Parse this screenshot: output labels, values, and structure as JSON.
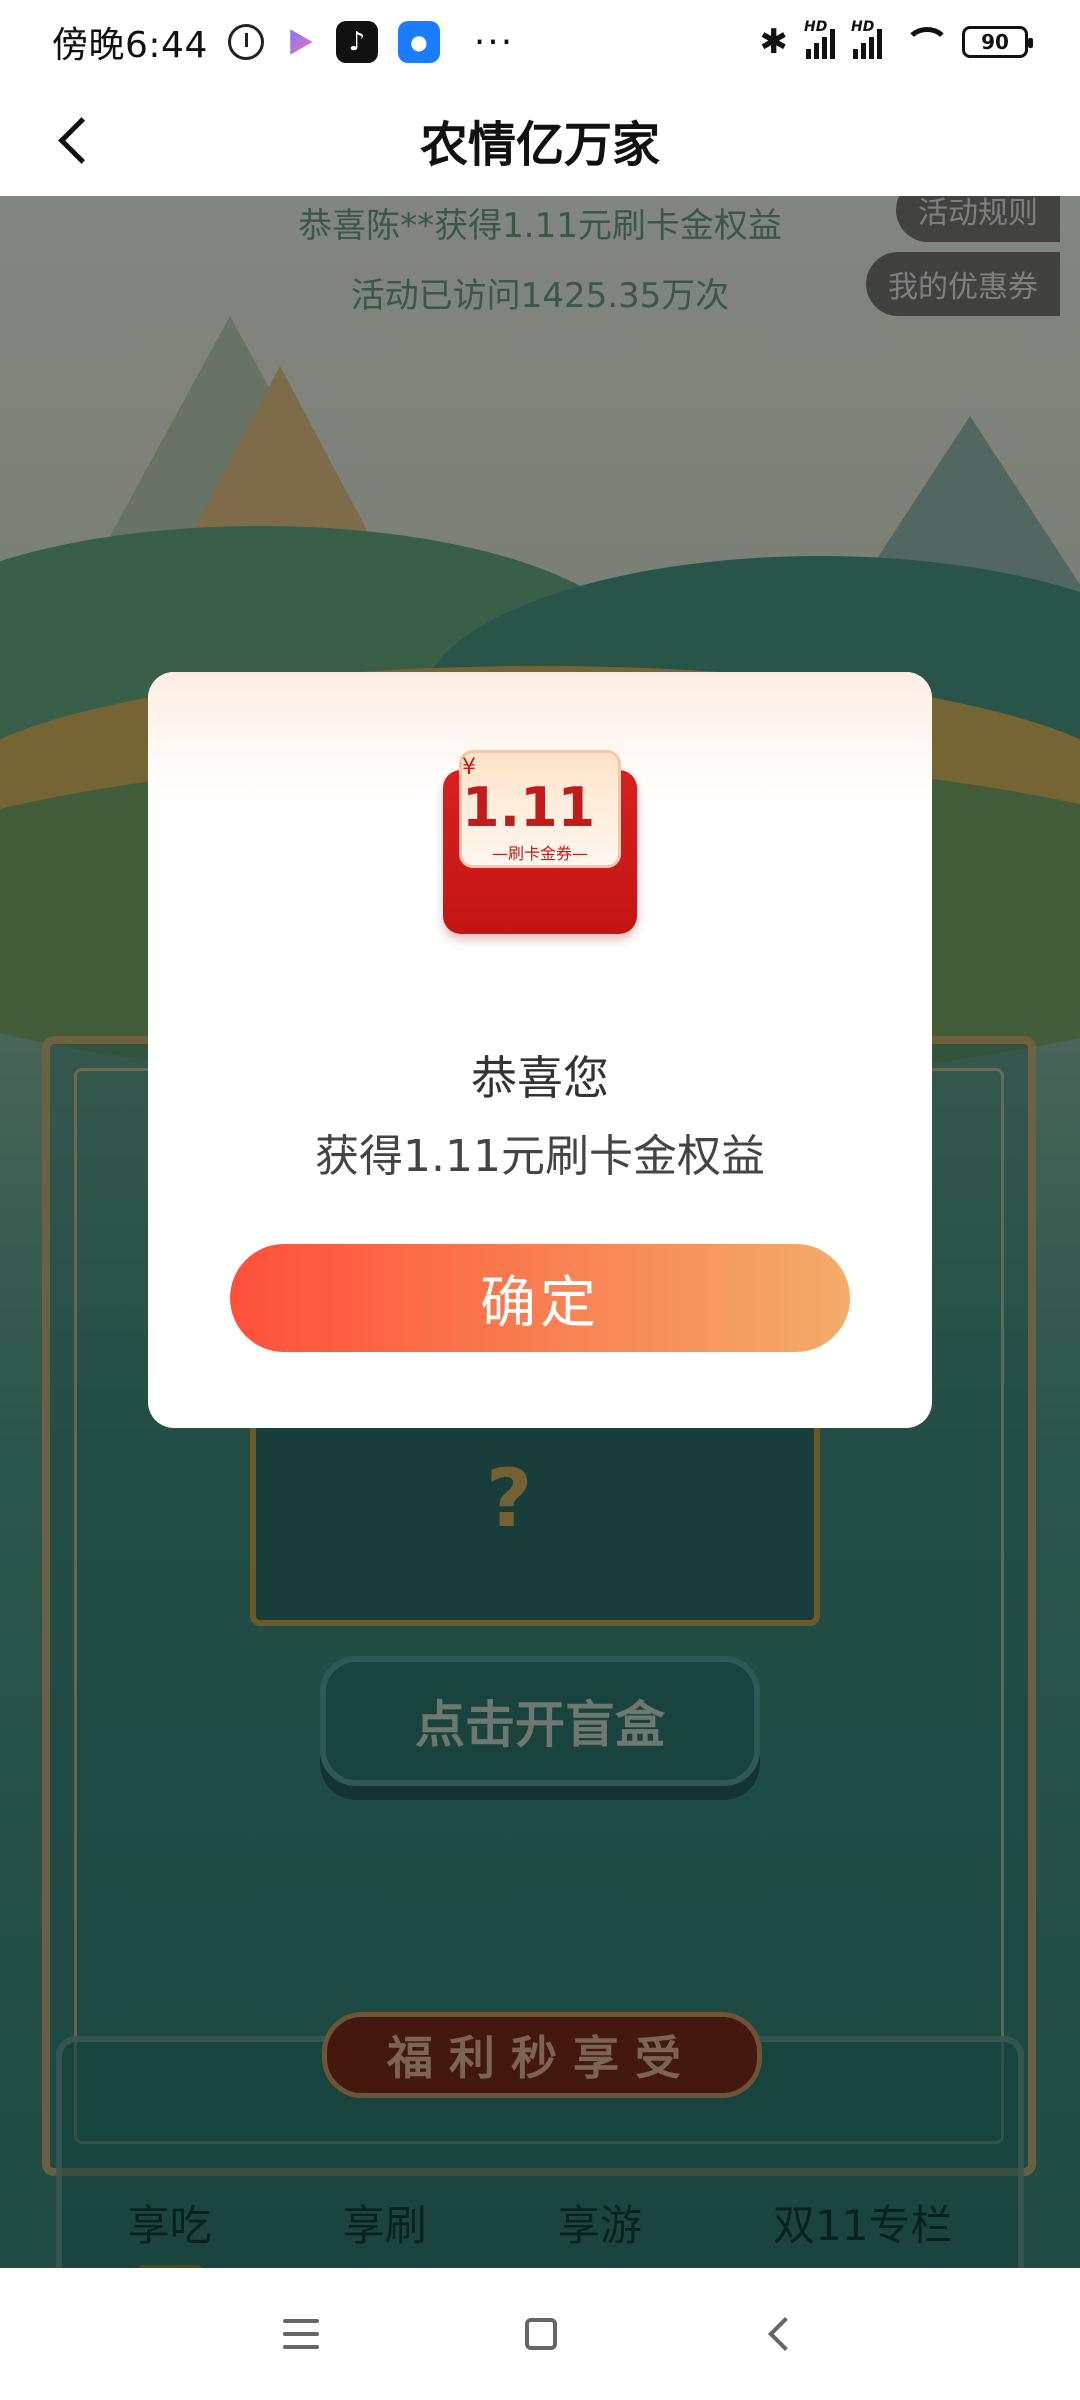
{
  "status_bar": {
    "time": "傍晚6:44",
    "more": "···",
    "battery": "90",
    "hd_label": "HD"
  },
  "header": {
    "title": "农情亿万家"
  },
  "page": {
    "notice_winner": "恭喜陈**获得1.11元刷卡金权益",
    "notice_visits": "活动已访问1425.35万次",
    "rules_label": "活动规则",
    "coupons_label": "我的优惠券",
    "open_box_label": "点击开盲盒",
    "benefits_title": "福利秒享受",
    "tabs": [
      "享吃",
      "享刷",
      "享游",
      "双11专栏"
    ]
  },
  "modal": {
    "coupon_currency": "¥",
    "coupon_amount": "1.11",
    "coupon_label": "—刷卡金券—",
    "title": "恭喜您",
    "subtitle": "获得1.11元刷卡金权益",
    "confirm_label": "确定"
  },
  "colors": {
    "accent_start": "#ff4f3a",
    "accent_end": "#f3ad6a"
  }
}
